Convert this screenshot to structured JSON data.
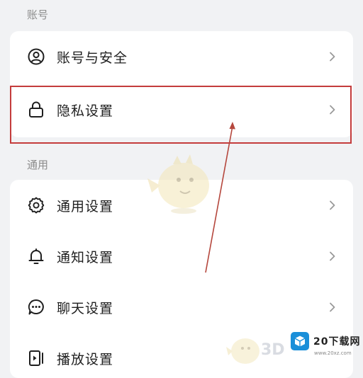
{
  "sections": {
    "account": {
      "label": "账号",
      "items": [
        {
          "label": "账号与安全",
          "icon": "user-circle-icon"
        },
        {
          "label": "隐私设置",
          "icon": "lock-icon"
        }
      ]
    },
    "general": {
      "label": "通用",
      "items": [
        {
          "label": "通用设置",
          "icon": "gear-icon"
        },
        {
          "label": "通知设置",
          "icon": "bell-icon"
        },
        {
          "label": "聊天设置",
          "icon": "chat-bubble-icon"
        },
        {
          "label": "播放设置",
          "icon": "play-device-icon"
        }
      ]
    }
  },
  "watermark": {
    "brand": "20下载网",
    "brand_sub": "www.20xz.com",
    "faint_text": "3D"
  },
  "colors": {
    "background": "#f1f2f4",
    "card": "#ffffff",
    "highlight": "#c43c3c",
    "text": "#1f1f1f",
    "muted": "#8c8c8c"
  }
}
